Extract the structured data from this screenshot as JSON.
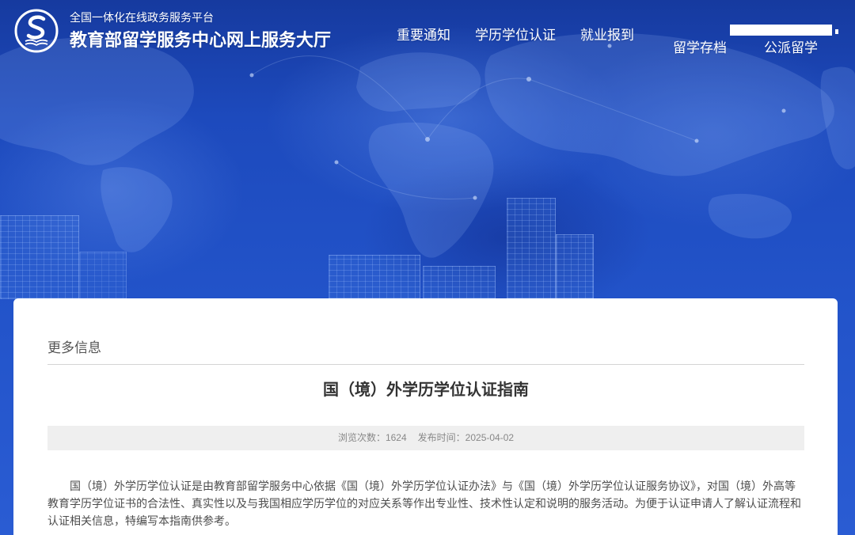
{
  "header": {
    "logo_icon": "site-logo-icon",
    "platform_label": "全国一体化在线政务服务平台",
    "site_title": "教育部留学服务中心网上服务大厅"
  },
  "nav": {
    "items": [
      {
        "label": "重要通知"
      },
      {
        "label": "学历学位认证"
      },
      {
        "label": "就业报到"
      },
      {
        "label": "留学存档"
      },
      {
        "label": "公派留学"
      }
    ]
  },
  "breadcrumb": {
    "section": "更多信息"
  },
  "article": {
    "title": "国（境）外学历学位认证指南",
    "meta": {
      "views_label": "浏览次数：",
      "views": 1624,
      "publish_label": "发布时间：",
      "publish_date": "2025-04-02"
    },
    "paragraph_lines": [
      "国（境）外学历学位认证是由教育部留学服务中心依据《国（境）外学历学位认证办法》与《国（境）外学历学位认证服务协议》，对国（境）外高等",
      "教育学历学位证书的合法性、真实性以及与我国相应学历学位的对应关系等作出专业性、技术性认定和说明的服务活动。为便于认证申请人了解认证流程和",
      "认证相关信息，特编写本指南供参考。"
    ]
  },
  "colors": {
    "brand_blue": "#2253c9",
    "header_text": "#ffffff",
    "card_bg": "#ffffff",
    "meta_bar_bg": "#efefef",
    "title_text": "#333333",
    "body_text": "#4d4d4d",
    "muted_text": "#888888",
    "divider": "#d4d4d4"
  }
}
